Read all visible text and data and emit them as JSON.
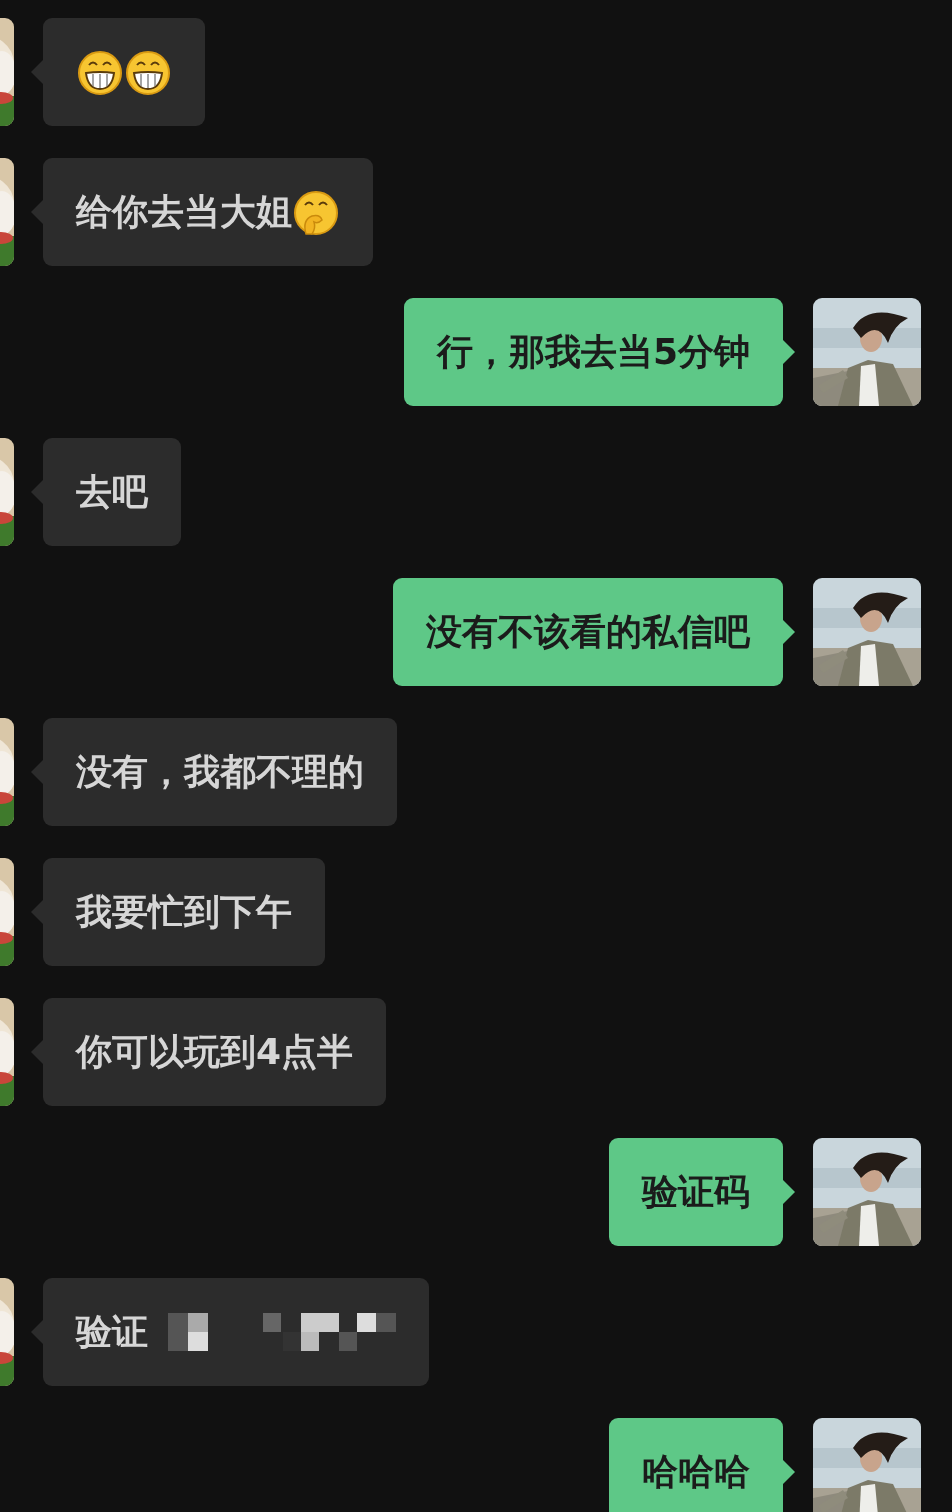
{
  "messages": [
    {
      "outgoing": false,
      "emojis": [
        {
          "kind": "grin"
        },
        {
          "kind": "grin"
        }
      ]
    },
    {
      "outgoing": false,
      "text": "给你去当大姐",
      "emojis": [
        {
          "kind": "giggle"
        }
      ]
    },
    {
      "outgoing": true,
      "text": "行，那我去当5分钟"
    },
    {
      "outgoing": false,
      "text": "去吧"
    },
    {
      "outgoing": true,
      "text": "没有不该看的私信吧"
    },
    {
      "outgoing": false,
      "text": "没有，我都不理的"
    },
    {
      "outgoing": false,
      "text": "我要忙到下午"
    },
    {
      "outgoing": false,
      "text": "你可以玩到4点半"
    },
    {
      "outgoing": true,
      "text": "验证码"
    },
    {
      "outgoing": false,
      "text": "验证",
      "redacted": true
    },
    {
      "outgoing": true,
      "text": "哈哈哈"
    }
  ]
}
